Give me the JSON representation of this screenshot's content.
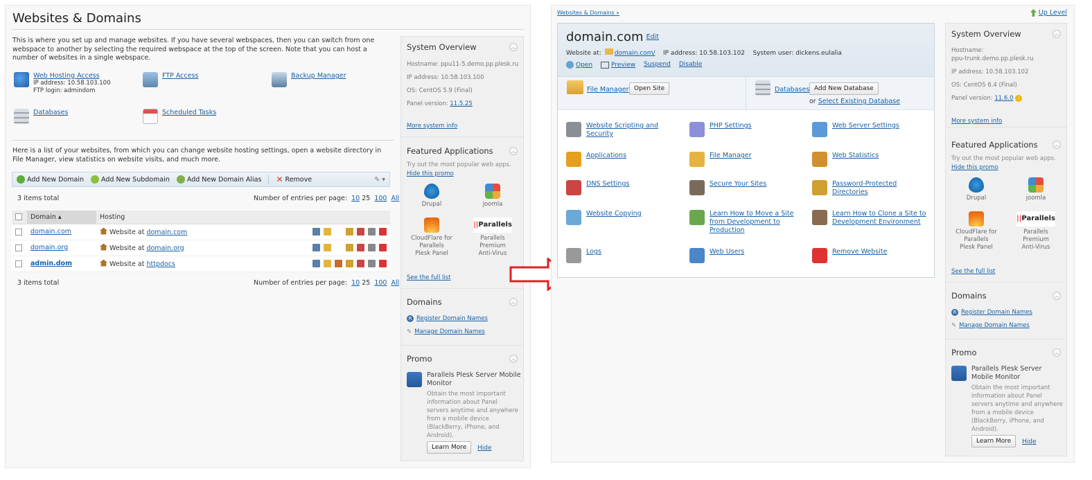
{
  "left": {
    "title": "Websites & Domains",
    "intro1": "This is where you set up and manage websites. If you have several webspaces, then you can switch from one webspace to another by selecting the required webspace at the top of the screen. Note that you can host a number of websites in a single webspace.",
    "tools": [
      {
        "label": "Web Hosting Access",
        "meta1": "IP address: 10.58.103.100",
        "meta2": "FTP login: admindom",
        "icon": "web-hosting-icon"
      },
      {
        "label": "FTP Access",
        "icon": "ftp-icon"
      },
      {
        "label": "Backup Manager",
        "icon": "backup-icon"
      },
      {
        "label": "Databases",
        "icon": "database-icon"
      },
      {
        "label": "Scheduled Tasks",
        "icon": "calendar-icon"
      }
    ],
    "intro2": "Here is a list of your websites, from which you can change website hosting settings, open a website directory in File Manager, view statistics on website visits, and much more.",
    "toolbar": {
      "add_domain": "Add New Domain",
      "add_subdomain": "Add New Subdomain",
      "add_alias": "Add New Domain Alias",
      "remove": "Remove"
    },
    "items_total": "3 items total",
    "entries_label": "Number of entries per page:",
    "pages": [
      "10",
      "25",
      "100",
      "All"
    ],
    "columns": {
      "domain": "Domain ▴",
      "hosting": "Hosting"
    },
    "rows": [
      {
        "domain": "domain.com",
        "prefix": "Website at",
        "link": "domain.com"
      },
      {
        "domain": "domain.org",
        "prefix": "Website at",
        "link": "domain.org"
      },
      {
        "domain": "admin.dom",
        "prefix": "Website at",
        "link": "httpdocs"
      }
    ]
  },
  "left_side": {
    "overview_title": "System Overview",
    "hostname": "Hostname: ppu11-5.demo.pp.plesk.ru",
    "ip": "IP address: 10.58.103.100",
    "os": "OS: CentOS 5.9 (Final)",
    "panel_label": "Panel version:",
    "panel_value": "11.5.25",
    "more_info": "More system info",
    "featured_title": "Featured Applications",
    "featured_desc": "Try out the most popular web apps.",
    "hide_promo": "Hide this promo",
    "apps": [
      {
        "name": "Drupal"
      },
      {
        "name": "joomla"
      },
      {
        "name": "CloudFlare for Parallels Plesk Panel"
      },
      {
        "name": "Parallels Premium Anti-Virus"
      }
    ],
    "full_list": "See the full list",
    "domains_title": "Domains",
    "register": "Register Domain Names",
    "manage": "Manage Domain Names",
    "promo_title": "Promo",
    "promo_heading": "Parallels Plesk Server Mobile Monitor",
    "promo_desc": "Obtain the most important information about Panel servers anytime and anywhere from a mobile device (BlackBerry, iPhone, and Android).",
    "learn_more": "Learn More",
    "hide": "Hide"
  },
  "right": {
    "breadcrumb": "Websites & Domains »",
    "up_level": "Up Level",
    "domain": "domain.com",
    "edit": "Edit",
    "website_at": "Website at:",
    "website_link": "domain.com/",
    "ip": "IP address: 10.58.103.102",
    "user": "System user: dickens.eulalia",
    "actions": {
      "open": "Open",
      "preview": "Preview",
      "suspend": "Suspend",
      "disable": "Disable"
    },
    "file_manager": "File Manager",
    "open_site": "Open Site",
    "databases": "Databases",
    "add_db": "Add New Database",
    "or": "or",
    "select_db": "Select Existing Database",
    "features": [
      {
        "label": "Website Scripting and Security",
        "icon": "scripting-icon"
      },
      {
        "label": "PHP Settings",
        "icon": "php-icon"
      },
      {
        "label": "Web Server Settings",
        "icon": "web-server-icon"
      },
      {
        "label": "Applications",
        "icon": "gear-icon"
      },
      {
        "label": "File Manager",
        "icon": "folder-icon"
      },
      {
        "label": "Web Statistics",
        "icon": "statistics-icon"
      },
      {
        "label": "DNS Settings",
        "icon": "dns-icon"
      },
      {
        "label": "Secure Your Sites",
        "icon": "certificate-icon"
      },
      {
        "label": "Password-Protected Directories",
        "icon": "lock-folder-icon"
      },
      {
        "label": "Website Copying",
        "icon": "copy-icon"
      },
      {
        "label": "Learn How to Move a Site from Development to Production",
        "icon": "upload-icon"
      },
      {
        "label": "Learn How to Clone a Site to Development Environment",
        "icon": "house-icon"
      },
      {
        "label": "Logs",
        "icon": "log-icon"
      },
      {
        "label": "Web Users",
        "icon": "users-icon"
      },
      {
        "label": "Remove Website",
        "icon": "remove-icon"
      }
    ]
  },
  "right_side": {
    "overview_title": "System Overview",
    "hostname_label": "Hostname:",
    "hostname": "ppu-trunk.demo.pp.plesk.ru",
    "ip": "IP address: 10.58.103.102",
    "os": "OS: CentOS 6.4 (Final)",
    "panel_label": "Panel version:",
    "panel_value": "11.6.0",
    "more_info": "More system info",
    "featured_title": "Featured Applications",
    "featured_desc": "Try out the most popular web apps.",
    "hide_promo": "Hide this promo",
    "apps": [
      {
        "name": "Drupal"
      },
      {
        "name": "joomla"
      },
      {
        "name": "CloudFlare for Parallels Plesk Panel"
      },
      {
        "name": "Parallels Premium Anti-Virus"
      }
    ],
    "full_list": "See the full list",
    "domains_title": "Domains",
    "register": "Register Domain Names",
    "manage": "Manage Domain Names",
    "promo_title": "Promo",
    "promo_heading": "Parallels Plesk Server Mobile Monitor",
    "promo_desc": "Obtain the most important information about Panel servers anytime and anywhere from a mobile device (BlackBerry, iPhone, and Android).",
    "learn_more": "Learn More",
    "hide": "Hide"
  },
  "colors": {
    "link": "#1560a8",
    "arrow": "#e02020",
    "toolbar": "#dfe8f0"
  }
}
